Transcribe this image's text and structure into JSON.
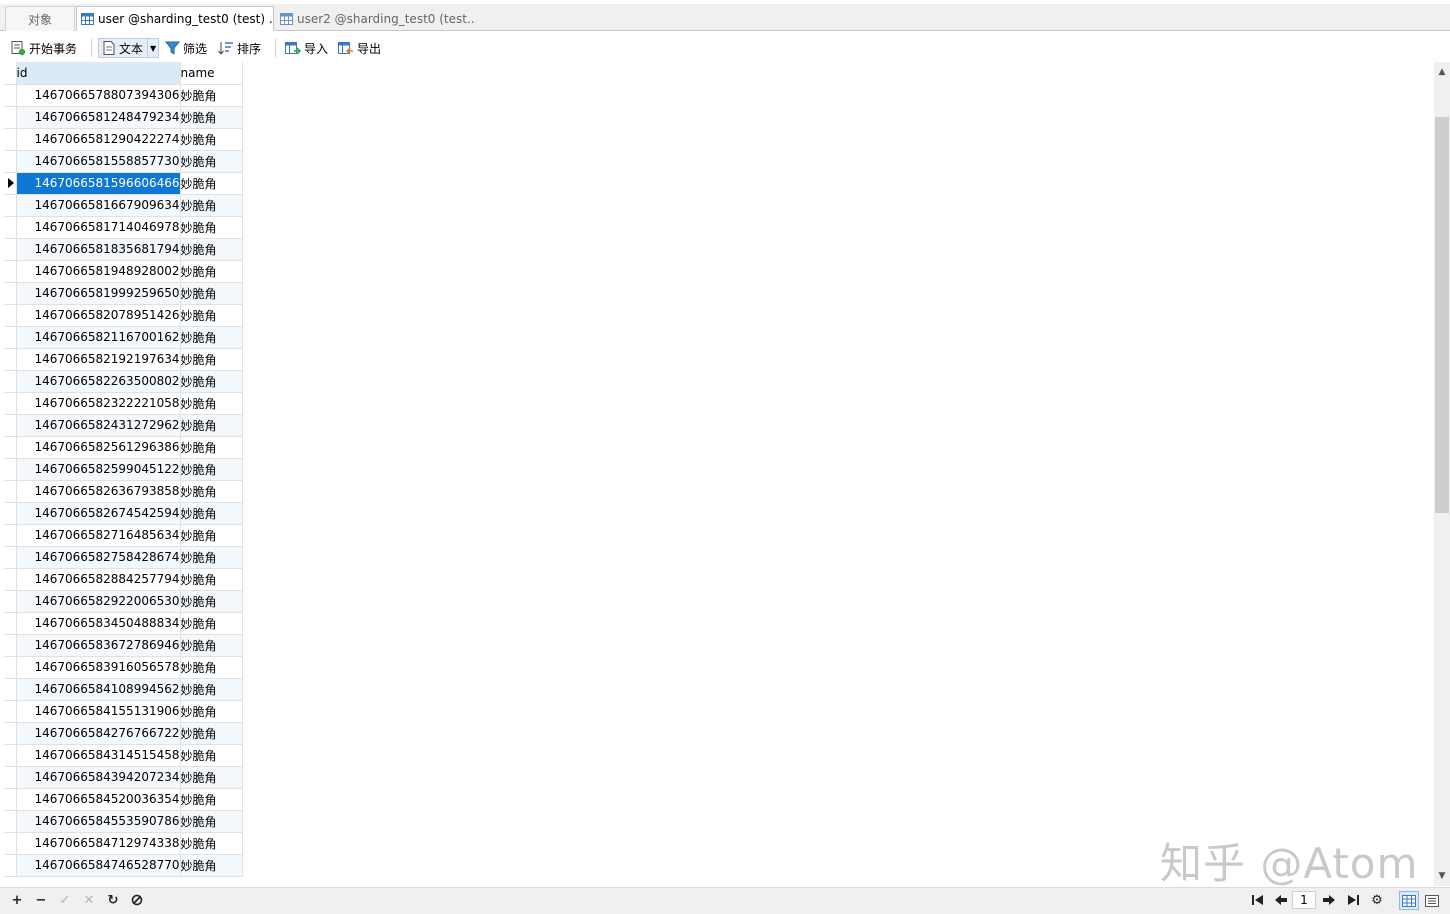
{
  "tabs": [
    {
      "label": "对象"
    },
    {
      "label": "user @sharding_test0 (test) ..."
    },
    {
      "label": "user2 @sharding_test0 (test..."
    }
  ],
  "toolbar": {
    "begin_transaction": "开始事务",
    "text": "文本",
    "filter": "筛选",
    "sort": "排序",
    "import": "导入",
    "export": "导出"
  },
  "grid": {
    "columns": [
      "id",
      "name"
    ],
    "selected_row_index": 4,
    "rows": [
      {
        "id": "1467066578807394306",
        "name": "妙脆角"
      },
      {
        "id": "1467066581248479234",
        "name": "妙脆角"
      },
      {
        "id": "1467066581290422274",
        "name": "妙脆角"
      },
      {
        "id": "1467066581558857730",
        "name": "妙脆角"
      },
      {
        "id": "1467066581596606466",
        "name": "妙脆角"
      },
      {
        "id": "1467066581667909634",
        "name": "妙脆角"
      },
      {
        "id": "1467066581714046978",
        "name": "妙脆角"
      },
      {
        "id": "1467066581835681794",
        "name": "妙脆角"
      },
      {
        "id": "1467066581948928002",
        "name": "妙脆角"
      },
      {
        "id": "1467066581999259650",
        "name": "妙脆角"
      },
      {
        "id": "1467066582078951426",
        "name": "妙脆角"
      },
      {
        "id": "1467066582116700162",
        "name": "妙脆角"
      },
      {
        "id": "1467066582192197634",
        "name": "妙脆角"
      },
      {
        "id": "1467066582263500802",
        "name": "妙脆角"
      },
      {
        "id": "1467066582322221058",
        "name": "妙脆角"
      },
      {
        "id": "1467066582431272962",
        "name": "妙脆角"
      },
      {
        "id": "1467066582561296386",
        "name": "妙脆角"
      },
      {
        "id": "1467066582599045122",
        "name": "妙脆角"
      },
      {
        "id": "1467066582636793858",
        "name": "妙脆角"
      },
      {
        "id": "1467066582674542594",
        "name": "妙脆角"
      },
      {
        "id": "1467066582716485634",
        "name": "妙脆角"
      },
      {
        "id": "1467066582758428674",
        "name": "妙脆角"
      },
      {
        "id": "1467066582884257794",
        "name": "妙脆角"
      },
      {
        "id": "1467066582922006530",
        "name": "妙脆角"
      },
      {
        "id": "1467066583450488834",
        "name": "妙脆角"
      },
      {
        "id": "1467066583672786946",
        "name": "妙脆角"
      },
      {
        "id": "1467066583916056578",
        "name": "妙脆角"
      },
      {
        "id": "1467066584108994562",
        "name": "妙脆角"
      },
      {
        "id": "1467066584155131906",
        "name": "妙脆角"
      },
      {
        "id": "1467066584276766722",
        "name": "妙脆角"
      },
      {
        "id": "1467066584314515458",
        "name": "妙脆角"
      },
      {
        "id": "1467066584394207234",
        "name": "妙脆角"
      },
      {
        "id": "1467066584520036354",
        "name": "妙脆角"
      },
      {
        "id": "1467066584553590786",
        "name": "妙脆角"
      },
      {
        "id": "1467066584712974338",
        "name": "妙脆角"
      },
      {
        "id": "1467066584746528770",
        "name": "妙脆角"
      }
    ]
  },
  "pager": {
    "page": "1"
  },
  "watermark": "知乎 @Atom",
  "colors": {
    "selection": "#0f78d7",
    "header_id_bg": "#dce9f7",
    "alt_row": "#f3f8fd"
  }
}
